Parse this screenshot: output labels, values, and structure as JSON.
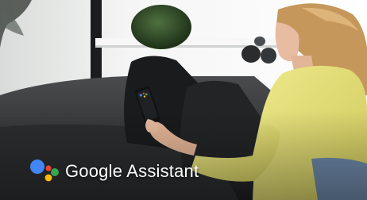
{
  "brand": {
    "text": "Google Assistant",
    "logo_name": "google-assistant-dots",
    "logo_colors": [
      "#4285F4",
      "#EA4335",
      "#FBBC05",
      "#34A853"
    ]
  },
  "scene": {
    "description_colors": {
      "wall": "#eef0ef",
      "sofa": "#2a2a2c",
      "cushion": "#1b1b1d",
      "shirt": "#e5e07a",
      "hair": "#c79a5a",
      "skin": "#e9bfa5",
      "plant": "#2f4a25"
    }
  }
}
